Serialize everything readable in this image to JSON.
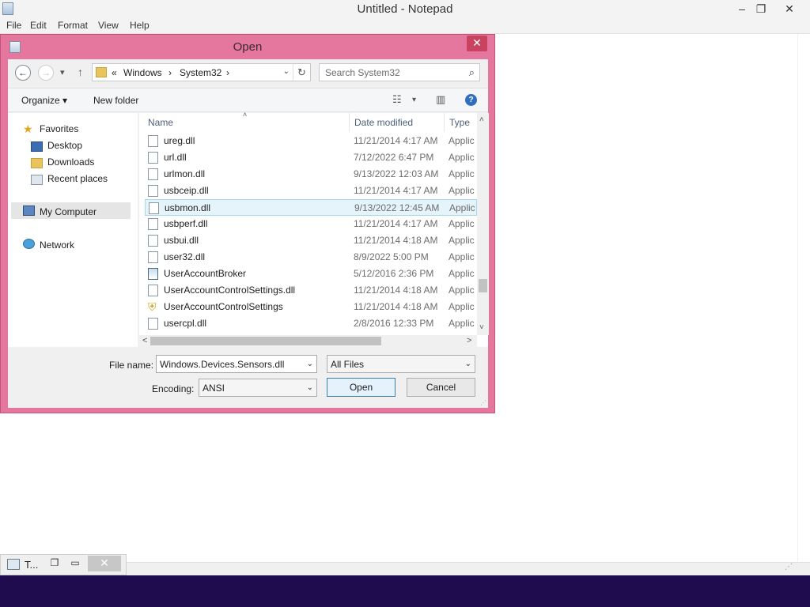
{
  "notepad": {
    "title": "Untitled - Notepad",
    "menu": [
      "File",
      "Edit",
      "Format",
      "View",
      "Help"
    ],
    "controls": {
      "minimize": "–",
      "restore": "❐",
      "close": "✕"
    }
  },
  "minimized": {
    "label": "T...",
    "restore": "❐",
    "maximize": "▭",
    "close": "✕"
  },
  "dialog": {
    "title": "Open",
    "close": "✕",
    "address": {
      "prefix": "«",
      "crumbs": [
        "Windows",
        "System32"
      ],
      "sep": "›",
      "dropdown": "⌄",
      "refresh": "↻"
    },
    "search": {
      "placeholder": "Search System32",
      "icon": "⌕"
    },
    "toolbar": {
      "organize": "Organize ▾",
      "new_folder": "New folder",
      "view_drop": "▾",
      "help": "?"
    },
    "nav": {
      "favorites": "Favorites",
      "desktop": "Desktop",
      "downloads": "Downloads",
      "recent": "Recent places",
      "computer": "My Computer",
      "network": "Network"
    },
    "columns": {
      "name": "Name",
      "date": "Date modified",
      "type": "Type",
      "sort": "˄"
    },
    "files": [
      {
        "name": "ureg.dll",
        "date": "11/21/2014 4:17 AM",
        "type": "Applic",
        "icon": "dll"
      },
      {
        "name": "url.dll",
        "date": "7/12/2022 6:47 PM",
        "type": "Applic",
        "icon": "dll"
      },
      {
        "name": "urlmon.dll",
        "date": "9/13/2022 12:03 AM",
        "type": "Applic",
        "icon": "dll"
      },
      {
        "name": "usbceip.dll",
        "date": "11/21/2014 4:17 AM",
        "type": "Applic",
        "icon": "dll"
      },
      {
        "name": "usbmon.dll",
        "date": "9/13/2022 12:45 AM",
        "type": "Applic",
        "icon": "dll"
      },
      {
        "name": "usbperf.dll",
        "date": "11/21/2014 4:17 AM",
        "type": "Applic",
        "icon": "dll"
      },
      {
        "name": "usbui.dll",
        "date": "11/21/2014 4:18 AM",
        "type": "Applic",
        "icon": "dll"
      },
      {
        "name": "user32.dll",
        "date": "8/9/2022 5:00 PM",
        "type": "Applic",
        "icon": "dll"
      },
      {
        "name": "UserAccountBroker",
        "date": "5/12/2016 2:36 PM",
        "type": "Applic",
        "icon": "exe"
      },
      {
        "name": "UserAccountControlSettings.dll",
        "date": "11/21/2014 4:18 AM",
        "type": "Applic",
        "icon": "dll"
      },
      {
        "name": "UserAccountControlSettings",
        "date": "11/21/2014 4:18 AM",
        "type": "Applic",
        "icon": "shield"
      },
      {
        "name": "usercpl.dll",
        "date": "2/8/2016 12:33 PM",
        "type": "Applic",
        "icon": "dll"
      }
    ],
    "selected_index": 4,
    "scroll": {
      "up": "˄",
      "down": "˅",
      "left": "<",
      "right": ">"
    },
    "form": {
      "file_name_label": "File name:",
      "file_name_value": "Windows.Devices.Sensors.dll",
      "filter_value": "All Files",
      "encoding_label": "Encoding:",
      "encoding_value": "ANSI",
      "dropdown": "⌄",
      "open": "Open",
      "cancel": "Cancel"
    }
  }
}
